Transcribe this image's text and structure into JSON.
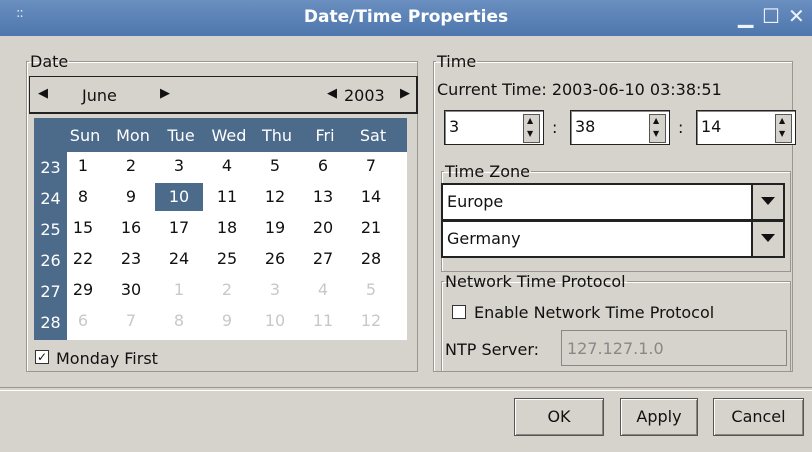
{
  "window": {
    "title": "Date/Time Properties",
    "grip": "::"
  },
  "date_panel": {
    "legend": "Date",
    "month": "June",
    "year": "2003",
    "weekdays": [
      "Sun",
      "Mon",
      "Tue",
      "Wed",
      "Thu",
      "Fri",
      "Sat"
    ],
    "weeks": [
      {
        "num": "23",
        "days": [
          "1",
          "2",
          "3",
          "4",
          "5",
          "6",
          "7"
        ]
      },
      {
        "num": "24",
        "days": [
          "8",
          "9",
          "10",
          "11",
          "12",
          "13",
          "14"
        ]
      },
      {
        "num": "25",
        "days": [
          "15",
          "16",
          "17",
          "18",
          "19",
          "20",
          "21"
        ]
      },
      {
        "num": "26",
        "days": [
          "22",
          "23",
          "24",
          "25",
          "26",
          "27",
          "28"
        ]
      },
      {
        "num": "27",
        "days": [
          "29",
          "30",
          "1",
          "2",
          "3",
          "4",
          "5"
        ]
      },
      {
        "num": "28",
        "days": [
          "6",
          "7",
          "8",
          "9",
          "10",
          "11",
          "12"
        ]
      }
    ],
    "monday_first_label": "Monday First",
    "monday_first_checked": "✓"
  },
  "time_panel": {
    "legend": "Time",
    "current_time_label": "Current Time: 2003-06-10  03:38:51",
    "hour": "3",
    "minute": "38",
    "second": "14",
    "separator": ":"
  },
  "timezone": {
    "legend": "Time Zone",
    "region": "Europe",
    "country": "Germany"
  },
  "ntp": {
    "legend": "Network Time Protocol",
    "enable_label": "Enable Network Time Protocol",
    "server_label": "NTP Server:",
    "server_value": "127.127.1.0"
  },
  "buttons": {
    "ok": "OK",
    "apply": "Apply",
    "cancel": "Cancel"
  }
}
